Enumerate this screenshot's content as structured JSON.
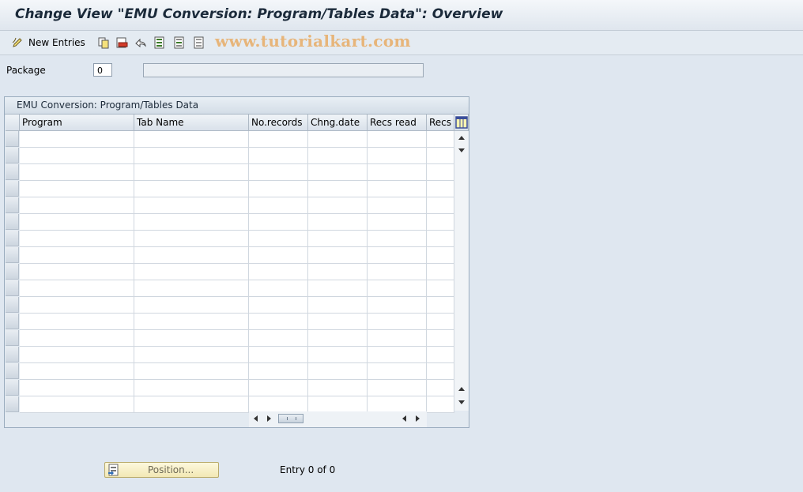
{
  "window": {
    "title": "Change View \"EMU Conversion: Program/Tables Data\": Overview"
  },
  "toolbar": {
    "new_entries_label": "New Entries",
    "icons": [
      "edit-pencil-icon",
      "copy-icon",
      "delete-icon",
      "undo-icon",
      "select-all-icon",
      "select-block-icon",
      "deselect-all-icon"
    ]
  },
  "watermark": "www.tutorialkart.com",
  "package": {
    "label": "Package",
    "value": "0",
    "description": ""
  },
  "table": {
    "title": "EMU Conversion: Program/Tables Data",
    "columns": [
      "Program",
      "Tab Name",
      "No.records",
      "Chng.date",
      "Recs read",
      "Recs c"
    ],
    "row_count": 17
  },
  "footer": {
    "position_label": "Position...",
    "entry_text": "Entry 0 of 0"
  }
}
